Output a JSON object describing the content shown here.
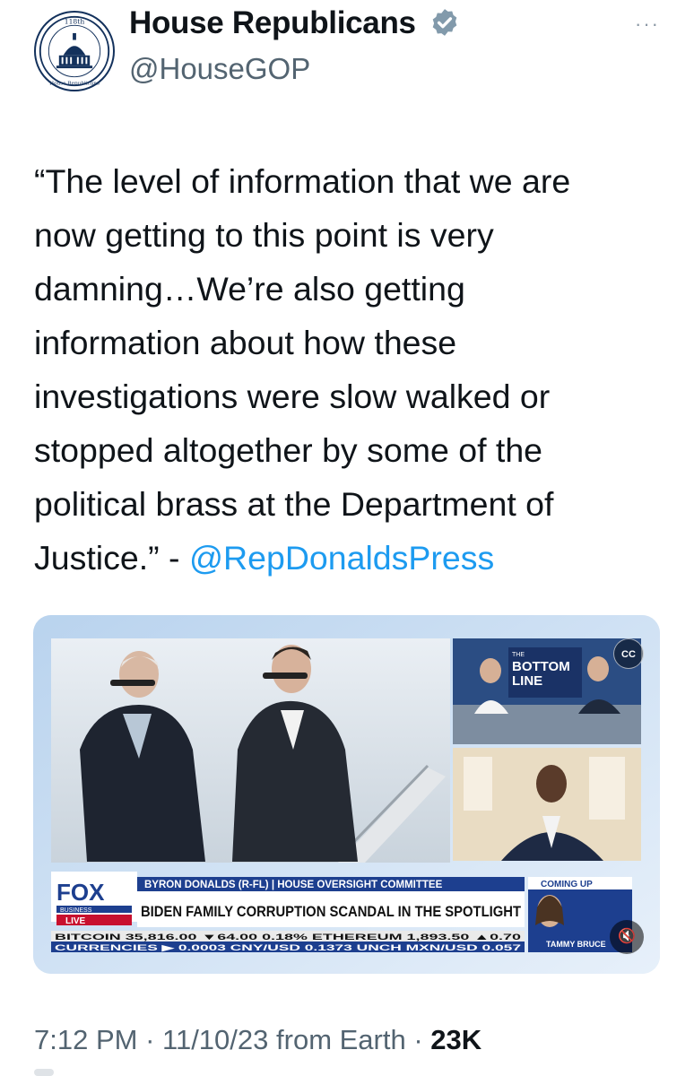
{
  "account": {
    "display_name": "House Republicans",
    "handle": "@HouseGOP",
    "verified": true,
    "avatar_text_top": "118th",
    "avatar_text_bottom": "House Republicans"
  },
  "more_button": "···",
  "tweet": {
    "lines": [
      "“The level of information that we are",
      "now getting to this point is very",
      "damning…We’re also getting",
      "information about how these",
      "investigations were slow walked or",
      "stopped altogether by some of the",
      "political brass at the Department of"
    ],
    "last_line_prefix": "Justice.” - ",
    "mention": "@RepDonaldsPress"
  },
  "media": {
    "cc_label": "CC",
    "mute_icon": "speaker-mute-icon",
    "logo_top": "FOX",
    "logo_sub": "BUSINESS",
    "live": "LIVE",
    "byline": "BYRON DONALDS (R-FL) | HOUSE OVERSIGHT COMMITTEE",
    "headline": "BIDEN FAMILY CORRUPTION SCANDAL IN THE SPOTLIGHT",
    "ticker_row1": "BITCOIN  35,816.00  ▼64.00  0.18%  ETHEREUM  1,893.50  ▲0.70",
    "ticker_row2": "CURRENCIES  ▶ 0.0003    CNY/USD 0.1373  UNCH    MXN/USD 0.057",
    "coming_up": "COMING UP",
    "show_name_1": "THE",
    "show_name_2": "BOTTOM",
    "show_name_3": "LINE",
    "host": "TAMMY BRUCE"
  },
  "meta": {
    "time": "7:12 PM",
    "date": "11/10/23",
    "source": "from Earth",
    "views": "23K"
  },
  "colors": {
    "mention_blue": "#1d9bf0",
    "verified_blue": "#829aab",
    "fox_blue": "#1d3f8f",
    "fox_red": "#c8102e"
  }
}
